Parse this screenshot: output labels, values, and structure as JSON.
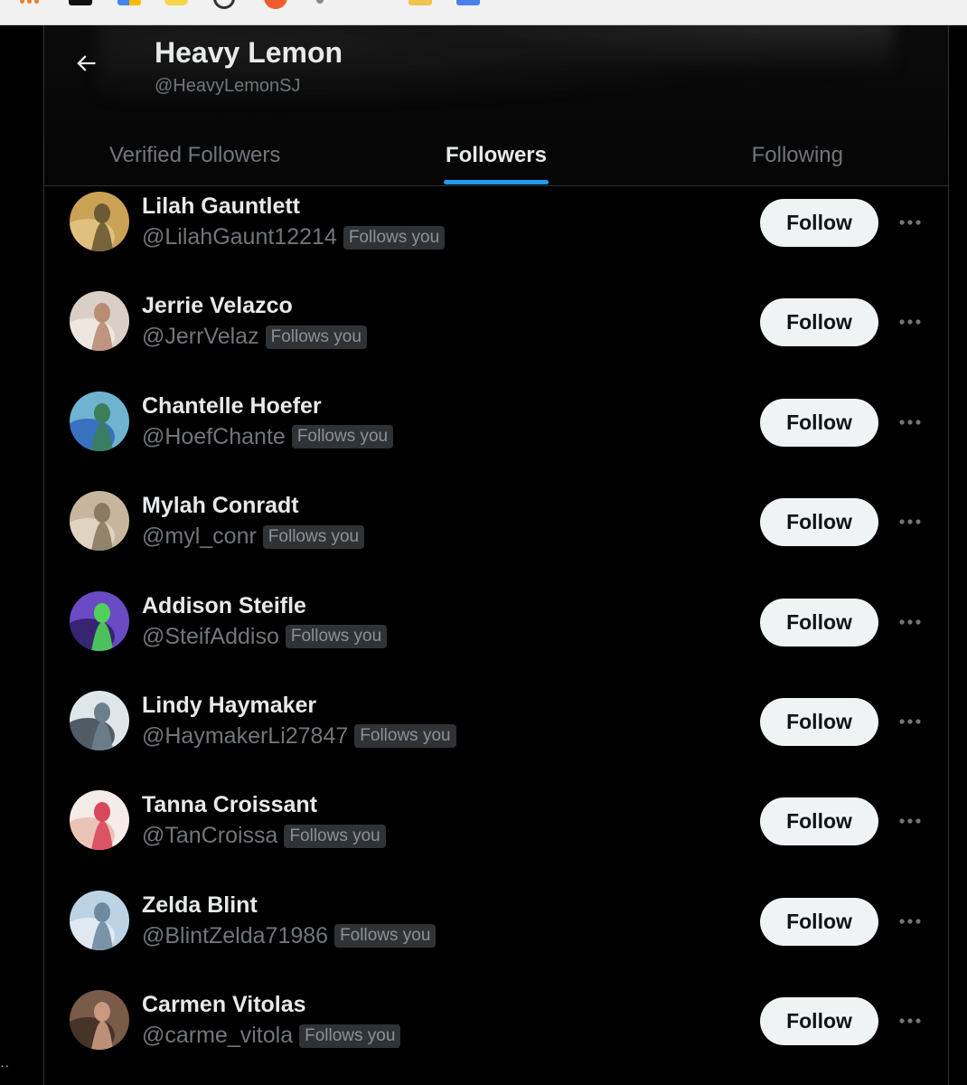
{
  "header": {
    "title": "Heavy Lemon",
    "handle": "@HeavyLemonSJ"
  },
  "tabs": [
    {
      "label": "Verified Followers",
      "active": false
    },
    {
      "label": "Followers",
      "active": true
    },
    {
      "label": "Following",
      "active": false
    }
  ],
  "followers": [
    {
      "name": "Lilah Gauntlett",
      "handle": "@LilahGaunt12214",
      "badge": "Follows you",
      "button": "Follow",
      "avatar_colors": [
        "#c9a255",
        "#6b5a34",
        "#e5c88a"
      ]
    },
    {
      "name": "Jerrie Velazco",
      "handle": "@JerrVelaz",
      "badge": "Follows you",
      "button": "Follow",
      "avatar_colors": [
        "#d9cfc6",
        "#b88d74",
        "#f2ece6"
      ]
    },
    {
      "name": "Chantelle Hoefer",
      "handle": "@HoefChante",
      "badge": "Follows you",
      "button": "Follow",
      "avatar_colors": [
        "#6fb3d1",
        "#3a7f5a",
        "#2a60b8"
      ]
    },
    {
      "name": "Mylah Conradt",
      "handle": "@myl_conr",
      "badge": "Follows you",
      "button": "Follow",
      "avatar_colors": [
        "#c7b59d",
        "#8a7a63",
        "#e6dccb"
      ]
    },
    {
      "name": "Addison Steifle",
      "handle": "@SteifAddiso",
      "badge": "Follows you",
      "button": "Follow",
      "avatar_colors": [
        "#6a4bc4",
        "#4fd15a",
        "#2b1c5e"
      ]
    },
    {
      "name": "Lindy Haymaker",
      "handle": "@HaymakerLi27847",
      "badge": "Follows you",
      "button": "Follow",
      "avatar_colors": [
        "#dfe6ea",
        "#6c7f8c",
        "#2c3a44"
      ]
    },
    {
      "name": "Tanna Croissant",
      "handle": "@TanCroissa",
      "badge": "Follows you",
      "button": "Follow",
      "avatar_colors": [
        "#f5ece7",
        "#d8485c",
        "#e9b9a8"
      ]
    },
    {
      "name": "Zelda Blint",
      "handle": "@BlintZelda71986",
      "badge": "Follows you",
      "button": "Follow",
      "avatar_colors": [
        "#bcd3e6",
        "#6f8aa0",
        "#e9eff5"
      ]
    },
    {
      "name": "Carmen Vitolas",
      "handle": "@carme_vitola",
      "badge": "Follows you",
      "button": "Follow",
      "avatar_colors": [
        "#7a5a48",
        "#c99a80",
        "#3b2a22"
      ]
    }
  ],
  "colors": {
    "accent": "#1d9bf0",
    "muted_text": "#71767b",
    "button_bg": "#eff3f4",
    "background": "#000000"
  },
  "icons": {
    "back": "arrow-left-icon",
    "more": "more-horizontal-icon"
  }
}
